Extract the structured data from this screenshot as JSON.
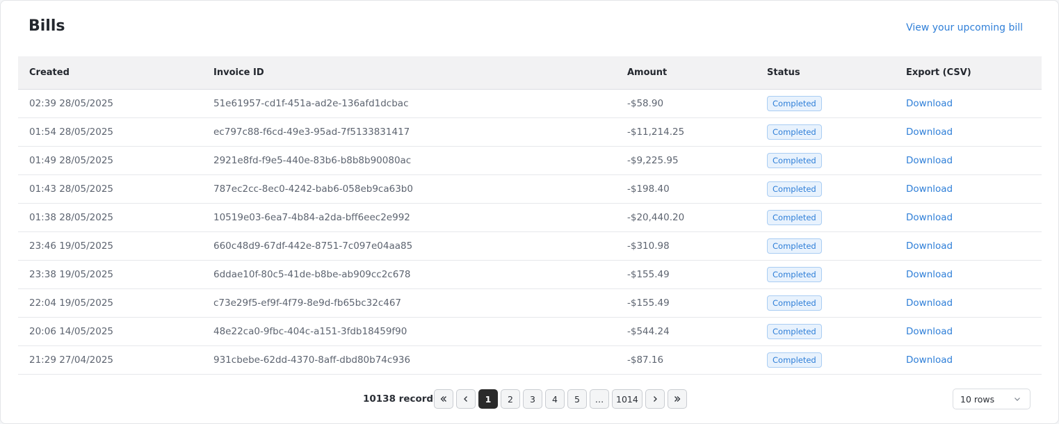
{
  "header": {
    "title": "Bills",
    "upcoming_link": "View your upcoming bill"
  },
  "table": {
    "columns": [
      "Created",
      "Invoice ID",
      "Amount",
      "Status",
      "Export (CSV)"
    ],
    "rows": [
      {
        "created": "02:39 28/05/2025",
        "invoice_id": "51e61957-cd1f-451a-ad2e-136afd1dcbac",
        "amount": "-$58.90",
        "status": "Completed",
        "export": "Download"
      },
      {
        "created": "01:54 28/05/2025",
        "invoice_id": "ec797c88-f6cd-49e3-95ad-7f5133831417",
        "amount": "-$11,214.25",
        "status": "Completed",
        "export": "Download"
      },
      {
        "created": "01:49 28/05/2025",
        "invoice_id": "2921e8fd-f9e5-440e-83b6-b8b8b90080ac",
        "amount": "-$9,225.95",
        "status": "Completed",
        "export": "Download"
      },
      {
        "created": "01:43 28/05/2025",
        "invoice_id": "787ec2cc-8ec0-4242-bab6-058eb9ca63b0",
        "amount": "-$198.40",
        "status": "Completed",
        "export": "Download"
      },
      {
        "created": "01:38 28/05/2025",
        "invoice_id": "10519e03-6ea7-4b84-a2da-bff6eec2e992",
        "amount": "-$20,440.20",
        "status": "Completed",
        "export": "Download"
      },
      {
        "created": "23:46 19/05/2025",
        "invoice_id": "660c48d9-67df-442e-8751-7c097e04aa85",
        "amount": "-$310.98",
        "status": "Completed",
        "export": "Download"
      },
      {
        "created": "23:38 19/05/2025",
        "invoice_id": "6ddae10f-80c5-41de-b8be-ab909cc2c678",
        "amount": "-$155.49",
        "status": "Completed",
        "export": "Download"
      },
      {
        "created": "22:04 19/05/2025",
        "invoice_id": "c73e29f5-ef9f-4f79-8e9d-fb65bc32c467",
        "amount": "-$155.49",
        "status": "Completed",
        "export": "Download"
      },
      {
        "created": "20:06 14/05/2025",
        "invoice_id": "48e22ca0-9fbc-404c-a151-3fdb18459f90",
        "amount": "-$544.24",
        "status": "Completed",
        "export": "Download"
      },
      {
        "created": "21:29 27/04/2025",
        "invoice_id": "931cbebe-62dd-4370-8aff-dbd80b74c936",
        "amount": "-$87.16",
        "status": "Completed",
        "export": "Download"
      }
    ]
  },
  "pagination": {
    "records_label": "10138 records",
    "pages": [
      "1",
      "2",
      "3",
      "4",
      "5",
      "…",
      "1014"
    ],
    "current_page": "1",
    "first_icon": "double-chevron-left-icon",
    "prev_icon": "chevron-left-icon",
    "next_icon": "chevron-right-icon",
    "last_icon": "double-chevron-right-icon"
  },
  "rows_per_page": {
    "value": "10 rows",
    "icon": "chevron-down-icon"
  },
  "colors": {
    "accent": "#2f7fd8",
    "badge_bg": "#e8f2fd",
    "active_page": "#2b2b2b"
  }
}
